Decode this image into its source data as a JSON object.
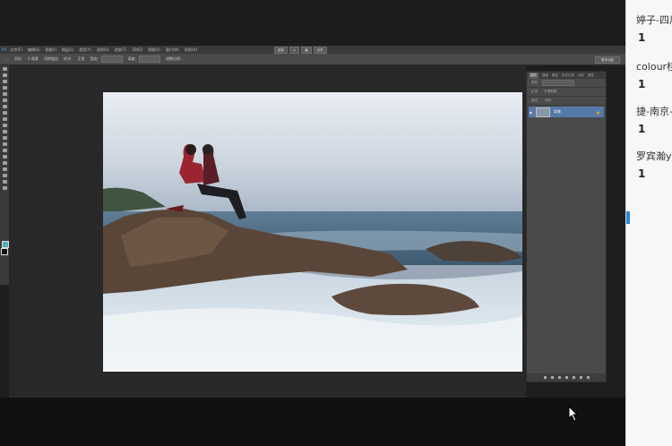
{
  "menubar": {
    "app_logo": "Ps",
    "items": [
      "文件(F)",
      "编辑(E)",
      "图像(I)",
      "图层(L)",
      "类型(Y)",
      "选择(S)",
      "滤镜(T)",
      "3D(D)",
      "视图(V)",
      "窗口(W)",
      "帮助(H)"
    ],
    "zoom_buttons": [
      "选择",
      "对齐"
    ]
  },
  "options_bar": {
    "items": [
      "羽化:",
      "0 像素",
      "消除锯齿",
      "样式:",
      "正常",
      "宽度:",
      "高度:",
      "调整边缘..."
    ],
    "workspace": "基本功能"
  },
  "layers_panel": {
    "tabs": [
      "图层",
      "通道",
      "路径",
      "历史记录",
      "动作",
      "属性"
    ],
    "kind_filter": "类型",
    "blend_mode": "正常",
    "opacity_label": "不透明度:",
    "lock_label": "锁定:",
    "fill_label": "填充:",
    "layer_name": "背景"
  },
  "chat": {
    "messages": [
      {
        "name": "婷子-四川",
        "count": "1"
      },
      {
        "name": "colour桂",
        "count": "1"
      },
      {
        "name": "捷-南京-",
        "count": "1"
      },
      {
        "name": "罗宾瀚yy",
        "count": "1"
      }
    ]
  }
}
